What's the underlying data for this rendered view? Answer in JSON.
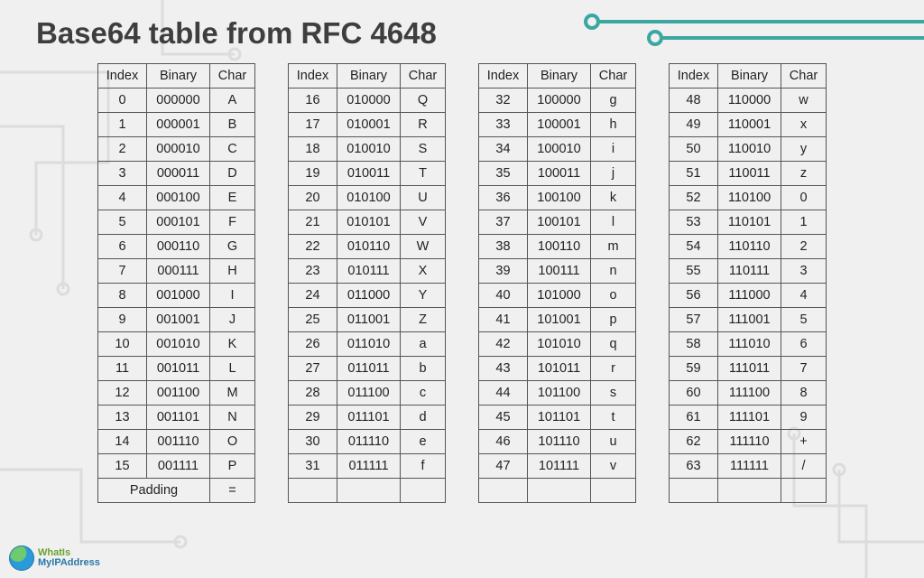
{
  "title": "Base64 table from RFC 4648",
  "headers": {
    "index": "Index",
    "binary": "Binary",
    "char": "Char"
  },
  "padding": {
    "label": "Padding",
    "char": "="
  },
  "columns": [
    [
      {
        "index": "0",
        "binary": "000000",
        "char": "A"
      },
      {
        "index": "1",
        "binary": "000001",
        "char": "B"
      },
      {
        "index": "2",
        "binary": "000010",
        "char": "C"
      },
      {
        "index": "3",
        "binary": "000011",
        "char": "D"
      },
      {
        "index": "4",
        "binary": "000100",
        "char": "E"
      },
      {
        "index": "5",
        "binary": "000101",
        "char": "F"
      },
      {
        "index": "6",
        "binary": "000110",
        "char": "G"
      },
      {
        "index": "7",
        "binary": "000111",
        "char": "H"
      },
      {
        "index": "8",
        "binary": "001000",
        "char": "I"
      },
      {
        "index": "9",
        "binary": "001001",
        "char": "J"
      },
      {
        "index": "10",
        "binary": "001010",
        "char": "K"
      },
      {
        "index": "11",
        "binary": "001011",
        "char": "L"
      },
      {
        "index": "12",
        "binary": "001100",
        "char": "M"
      },
      {
        "index": "13",
        "binary": "001101",
        "char": "N"
      },
      {
        "index": "14",
        "binary": "001110",
        "char": "O"
      },
      {
        "index": "15",
        "binary": "001111",
        "char": "P"
      }
    ],
    [
      {
        "index": "16",
        "binary": "010000",
        "char": "Q"
      },
      {
        "index": "17",
        "binary": "010001",
        "char": "R"
      },
      {
        "index": "18",
        "binary": "010010",
        "char": "S"
      },
      {
        "index": "19",
        "binary": "010011",
        "char": "T"
      },
      {
        "index": "20",
        "binary": "010100",
        "char": "U"
      },
      {
        "index": "21",
        "binary": "010101",
        "char": "V"
      },
      {
        "index": "22",
        "binary": "010110",
        "char": "W"
      },
      {
        "index": "23",
        "binary": "010111",
        "char": "X"
      },
      {
        "index": "24",
        "binary": "011000",
        "char": "Y"
      },
      {
        "index": "25",
        "binary": "011001",
        "char": "Z"
      },
      {
        "index": "26",
        "binary": "011010",
        "char": "a"
      },
      {
        "index": "27",
        "binary": "011011",
        "char": "b"
      },
      {
        "index": "28",
        "binary": "011100",
        "char": "c"
      },
      {
        "index": "29",
        "binary": "011101",
        "char": "d"
      },
      {
        "index": "30",
        "binary": "011110",
        "char": "e"
      },
      {
        "index": "31",
        "binary": "011111",
        "char": "f"
      }
    ],
    [
      {
        "index": "32",
        "binary": "100000",
        "char": "g"
      },
      {
        "index": "33",
        "binary": "100001",
        "char": "h"
      },
      {
        "index": "34",
        "binary": "100010",
        "char": "i"
      },
      {
        "index": "35",
        "binary": "100011",
        "char": "j"
      },
      {
        "index": "36",
        "binary": "100100",
        "char": "k"
      },
      {
        "index": "37",
        "binary": "100101",
        "char": "l"
      },
      {
        "index": "38",
        "binary": "100110",
        "char": "m"
      },
      {
        "index": "39",
        "binary": "100111",
        "char": "n"
      },
      {
        "index": "40",
        "binary": "101000",
        "char": "o"
      },
      {
        "index": "41",
        "binary": "101001",
        "char": "p"
      },
      {
        "index": "42",
        "binary": "101010",
        "char": "q"
      },
      {
        "index": "43",
        "binary": "101011",
        "char": "r"
      },
      {
        "index": "44",
        "binary": "101100",
        "char": "s"
      },
      {
        "index": "45",
        "binary": "101101",
        "char": "t"
      },
      {
        "index": "46",
        "binary": "101110",
        "char": "u"
      },
      {
        "index": "47",
        "binary": "101111",
        "char": "v"
      }
    ],
    [
      {
        "index": "48",
        "binary": "110000",
        "char": "w"
      },
      {
        "index": "49",
        "binary": "110001",
        "char": "x"
      },
      {
        "index": "50",
        "binary": "110010",
        "char": "y"
      },
      {
        "index": "51",
        "binary": "110011",
        "char": "z"
      },
      {
        "index": "52",
        "binary": "110100",
        "char": "0"
      },
      {
        "index": "53",
        "binary": "110101",
        "char": "1"
      },
      {
        "index": "54",
        "binary": "110110",
        "char": "2"
      },
      {
        "index": "55",
        "binary": "110111",
        "char": "3"
      },
      {
        "index": "56",
        "binary": "111000",
        "char": "4"
      },
      {
        "index": "57",
        "binary": "111001",
        "char": "5"
      },
      {
        "index": "58",
        "binary": "111010",
        "char": "6"
      },
      {
        "index": "59",
        "binary": "111011",
        "char": "7"
      },
      {
        "index": "60",
        "binary": "111100",
        "char": "8"
      },
      {
        "index": "61",
        "binary": "111101",
        "char": "9"
      },
      {
        "index": "62",
        "binary": "111110",
        "char": "+"
      },
      {
        "index": "63",
        "binary": "111111",
        "char": "/"
      }
    ]
  ],
  "logo": {
    "line1": "WhatIs",
    "line2": "MyIPAddress"
  }
}
